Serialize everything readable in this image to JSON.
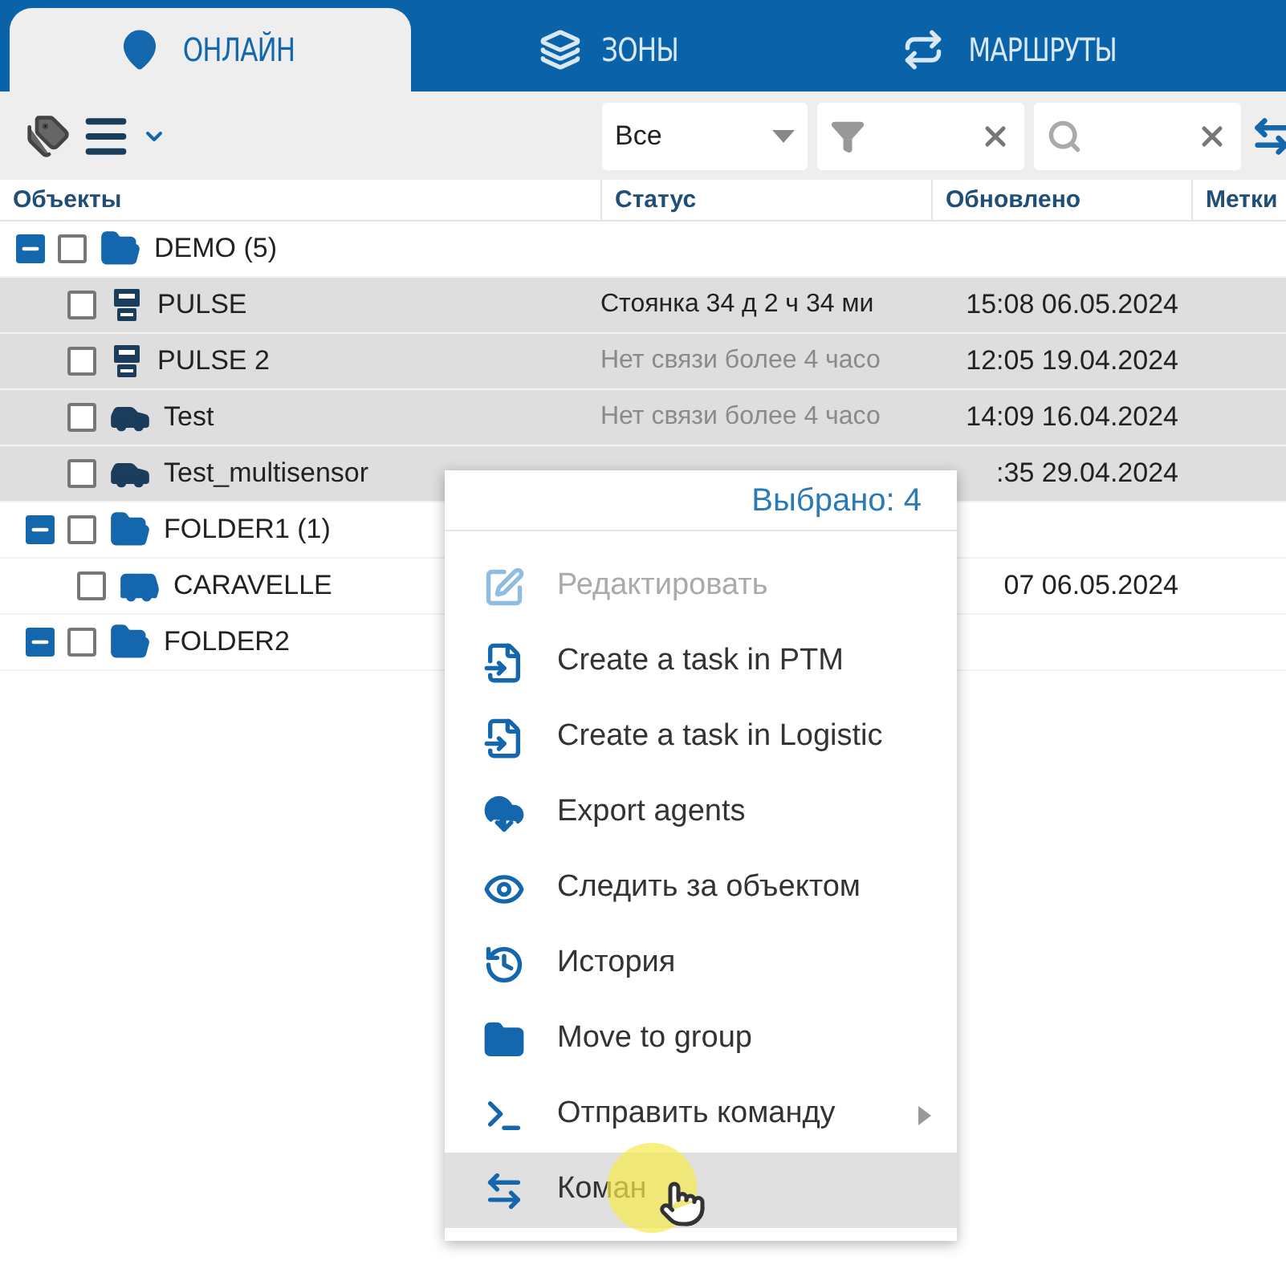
{
  "tabs": [
    {
      "label": "ОНЛАЙН",
      "selected": true
    },
    {
      "label": "ЗОНЫ",
      "selected": false
    },
    {
      "label": "МАРШРУТЫ",
      "selected": false
    }
  ],
  "toolbar": {
    "filter_select": {
      "value": "Все"
    }
  },
  "table": {
    "columns": [
      "Объекты",
      "Статус",
      "Обновлено",
      "Метки"
    ],
    "rows": [
      {
        "kind": "folder",
        "name": "DEMO (5)",
        "expanded": true,
        "checked": false,
        "selected": false,
        "children": [
          {
            "kind": "device",
            "name": "PULSE",
            "checked": false,
            "selected": true,
            "status": "Стоянка 34 д 2 ч 34 ми",
            "offline": false,
            "updated": "15:08 06.05.2024"
          },
          {
            "kind": "device",
            "name": "PULSE 2",
            "checked": false,
            "selected": true,
            "status": "Нет связи более 4 часо",
            "offline": true,
            "updated": "12:05 19.04.2024"
          },
          {
            "kind": "car",
            "name": "Test",
            "checked": false,
            "selected": true,
            "status": "Нет связи более 4 часо",
            "offline": true,
            "updated": "14:09 16.04.2024"
          },
          {
            "kind": "car",
            "name": "Test_multisensor",
            "checked": false,
            "selected": true,
            "updated": ":35 29.04.2024"
          },
          {
            "kind": "folder",
            "name": "FOLDER1 (1)",
            "expanded": true,
            "checked": false,
            "selected": false,
            "children": [
              {
                "kind": "van",
                "name": "CARAVELLE",
                "checked": false,
                "selected": false,
                "updated": "07 06.05.2024"
              }
            ]
          },
          {
            "kind": "folder",
            "name": "FOLDER2",
            "expanded": true,
            "checked": false,
            "selected": false
          }
        ]
      }
    ]
  },
  "context_menu": {
    "header": "Выбрано: 4",
    "items": [
      {
        "kind": "edit",
        "label": "Редактировать",
        "disabled": true,
        "submenu": false,
        "hovered": false
      },
      {
        "kind": "task",
        "label": "Create a task in PTM",
        "disabled": false,
        "submenu": false,
        "hovered": false
      },
      {
        "kind": "task",
        "label": "Create a task in Logistic",
        "disabled": false,
        "submenu": false,
        "hovered": false
      },
      {
        "kind": "export",
        "label": "Export agents",
        "disabled": false,
        "submenu": false,
        "hovered": false
      },
      {
        "kind": "watch",
        "label": "Следить за объектом",
        "disabled": false,
        "submenu": false,
        "hovered": false
      },
      {
        "kind": "history",
        "label": "История",
        "disabled": false,
        "submenu": false,
        "hovered": false
      },
      {
        "kind": "move",
        "label": "Move to group",
        "disabled": false,
        "submenu": false,
        "hovered": false
      },
      {
        "kind": "command",
        "label": "Отправить команду",
        "disabled": false,
        "submenu": true,
        "hovered": false
      },
      {
        "kind": "commands",
        "label": "Коман",
        "disabled": false,
        "submenu": false,
        "hovered": true
      }
    ]
  }
}
